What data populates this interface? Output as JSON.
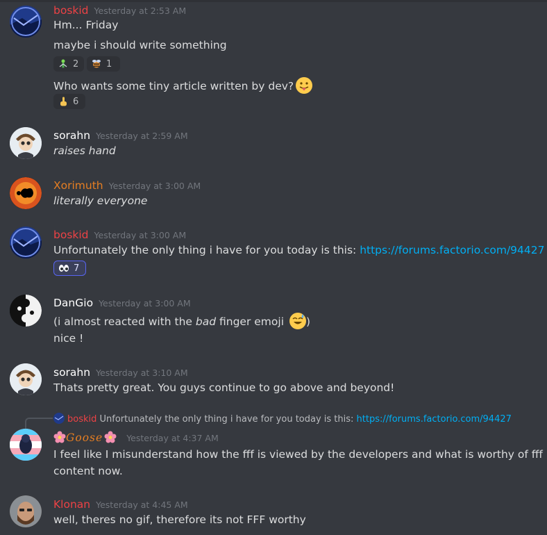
{
  "colors": {
    "background": "#36393f",
    "link": "#00aff4",
    "boskid": "#ed4245",
    "xorimuth": "#e67e22",
    "klonan": "#ed4245",
    "goose": "#e67e22",
    "white_name": "#ffffff"
  },
  "messages": [
    {
      "username": "boskid",
      "timestamp": "Yesterday at 2:53 AM",
      "lines": [
        "Hm... Friday",
        "maybe i should write something",
        "Who wants some tiny article written by dev?"
      ],
      "reactions_1": [
        {
          "icon": "person-icon",
          "count": "2"
        },
        {
          "icon": "bee-icon",
          "count": "1"
        }
      ],
      "reactions_2": [
        {
          "icon": "point-up-icon",
          "count": "6"
        }
      ]
    },
    {
      "username": "sorahn",
      "timestamp": "Yesterday at 2:59 AM",
      "lines": [
        "raises hand"
      ]
    },
    {
      "username": "Xorimuth",
      "timestamp": "Yesterday at 3:00 AM",
      "lines": [
        "literally everyone"
      ]
    },
    {
      "username": "boskid",
      "timestamp": "Yesterday at 3:00 AM",
      "text": "Unfortunately the only thing i have for you today is this: ",
      "link": "https://forums.factorio.com/94427",
      "reactions": [
        {
          "icon": "eyes-icon",
          "count": "7"
        }
      ]
    },
    {
      "username": "DanGio",
      "timestamp": "Yesterday at 3:00 AM",
      "line1_a": "(i almost reacted with the ",
      "line1_b": "bad",
      "line1_c": " finger emoji ",
      "line1_d": ")",
      "line2": "nice !"
    },
    {
      "username": "sorahn",
      "timestamp": "Yesterday at 3:10 AM",
      "lines": [
        "Thats pretty great.  You guys continue to go above and beyond!"
      ]
    },
    {
      "reply_username": "boskid",
      "reply_text": "Unfortunately the only thing i have for you today is this: ",
      "reply_link": "https://forums.factorio.com/94427",
      "username": "Goose",
      "timestamp": "Yesterday at 4:37 AM",
      "lines": [
        "I feel like I misunderstand how the fff is viewed by the developers and what is worthy of fff",
        "content now."
      ]
    },
    {
      "username": "Klonan",
      "timestamp": "Yesterday at 4:45 AM",
      "lines": [
        "well, theres no gif, therefore its not FFF worthy"
      ]
    }
  ]
}
